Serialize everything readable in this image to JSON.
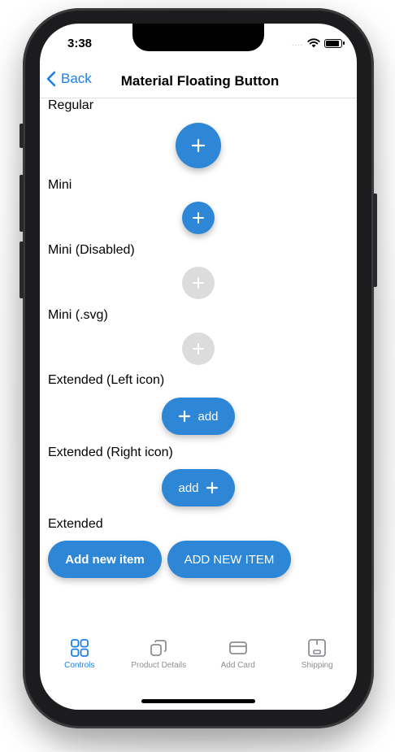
{
  "status_bar": {
    "time": "3:38",
    "signal": "....",
    "wifi_icon": "wifi-icon",
    "battery_icon": "battery-icon"
  },
  "navbar": {
    "back_label": "Back",
    "title": "Material Floating Button",
    "accent_color": "#1b80e6"
  },
  "sections": {
    "regular": {
      "label": "Regular",
      "icon": "+"
    },
    "mini": {
      "label": "Mini",
      "icon": "+"
    },
    "mini_disabled": {
      "label": "Mini (Disabled)",
      "icon": "+"
    },
    "mini_svg": {
      "label": "Mini (.svg)",
      "icon": "+"
    },
    "extended_left": {
      "label": "Extended (Left icon)",
      "icon": "+",
      "text": "add"
    },
    "extended_right": {
      "label": "Extended (Right icon)",
      "icon": "+",
      "text": "add"
    },
    "extended": {
      "label": "Extended",
      "button1": "Add new item",
      "button2": "ADD NEW ITEM"
    }
  },
  "colors": {
    "fab_primary": "#2e86d6",
    "fab_disabled": "#dcdcdc"
  },
  "tabbar": {
    "items": [
      {
        "label": "Controls",
        "icon": "grid-icon",
        "active": true
      },
      {
        "label": "Product Details",
        "icon": "copy-icon",
        "active": false
      },
      {
        "label": "Add Card",
        "icon": "card-icon",
        "active": false
      },
      {
        "label": "Shipping",
        "icon": "box-icon",
        "active": false
      }
    ]
  }
}
